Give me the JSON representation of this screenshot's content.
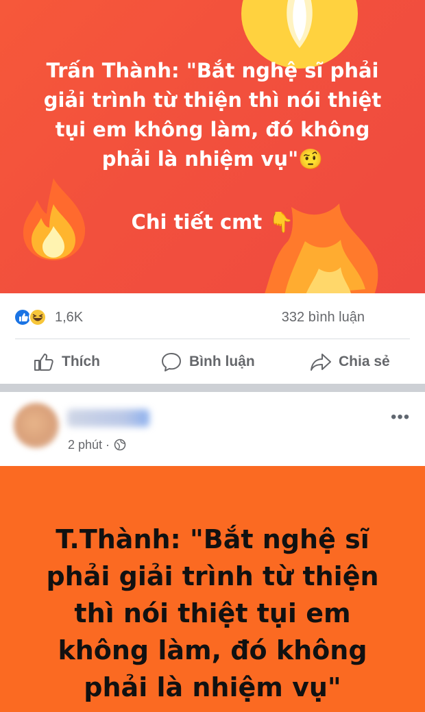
{
  "post1": {
    "quote_lines": [
      "Trấn Thành: \"Bắt nghệ sĩ phải",
      "giải trình từ thiện thì nói thiệt",
      "tụi em không làm, đó không",
      "phải là nhiệm vụ\""
    ],
    "quote_emoji": "🤨",
    "cta": "Chi tiết cmt",
    "cta_emoji": "👇",
    "background": "#f2503d"
  },
  "reactions": {
    "count": "1,6K",
    "comments": "332 bình luận",
    "icons": [
      "like-icon",
      "haha-icon"
    ]
  },
  "actions": {
    "like": "Thích",
    "comment": "Bình luận",
    "share": "Chia sẻ"
  },
  "post2": {
    "time": "2 phút ·",
    "more": "•••",
    "headline_lines": [
      "T.Thành: \"Bắt nghệ sĩ",
      "phải giải trình từ thiện",
      "thì nói thiệt tụi em",
      "không làm, đó không",
      "phải là nhiệm vụ\""
    ],
    "background": "#fb6a22"
  }
}
